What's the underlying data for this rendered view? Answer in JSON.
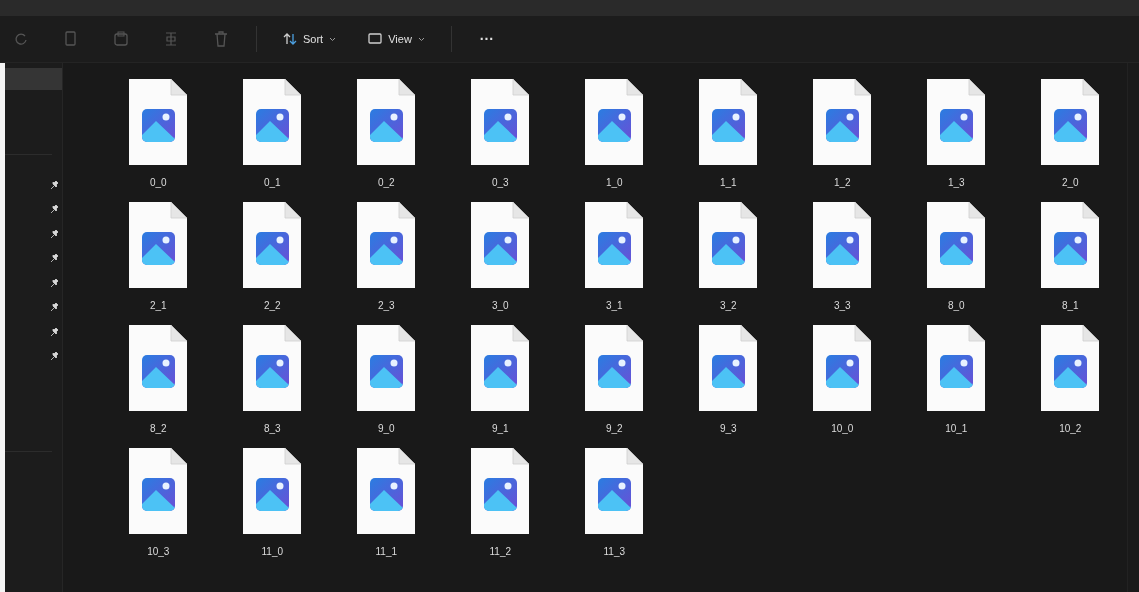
{
  "toolbar": {
    "icon_buttons": [
      {
        "kind": "rotate",
        "disabled": true
      },
      {
        "kind": "copy",
        "disabled": true
      },
      {
        "kind": "paste",
        "disabled": true
      },
      {
        "kind": "rename",
        "disabled": true
      },
      {
        "kind": "delete",
        "disabled": true
      }
    ],
    "menus": [
      {
        "kind": "sort",
        "label": "Sort"
      },
      {
        "kind": "view",
        "label": "View"
      }
    ],
    "more": "···"
  },
  "sidebar": {
    "items": [
      {
        "selected": true
      }
    ],
    "pinned_items": [
      {
        "pinned": true
      },
      {
        "pinned": true
      },
      {
        "pinned": true
      },
      {
        "pinned": true
      },
      {
        "pinned": true
      },
      {
        "pinned": true
      },
      {
        "pinned": true
      },
      {
        "pinned": true
      }
    ]
  },
  "files": [
    {
      "name": "0_0"
    },
    {
      "name": "0_1"
    },
    {
      "name": "0_2"
    },
    {
      "name": "0_3"
    },
    {
      "name": "1_0"
    },
    {
      "name": "1_1"
    },
    {
      "name": "1_2"
    },
    {
      "name": "1_3"
    },
    {
      "name": "2_0"
    },
    {
      "name": "2_1"
    },
    {
      "name": "2_2"
    },
    {
      "name": "2_3"
    },
    {
      "name": "3_0"
    },
    {
      "name": "3_1"
    },
    {
      "name": "3_2"
    },
    {
      "name": "3_3"
    },
    {
      "name": "8_0"
    },
    {
      "name": "8_1"
    },
    {
      "name": "8_2"
    },
    {
      "name": "8_3"
    },
    {
      "name": "9_0"
    },
    {
      "name": "9_1"
    },
    {
      "name": "9_2"
    },
    {
      "name": "9_3"
    },
    {
      "name": "10_0"
    },
    {
      "name": "10_1"
    },
    {
      "name": "10_2"
    },
    {
      "name": "10_3"
    },
    {
      "name": "11_0"
    },
    {
      "name": "11_1"
    },
    {
      "name": "11_2"
    },
    {
      "name": "11_3"
    }
  ]
}
